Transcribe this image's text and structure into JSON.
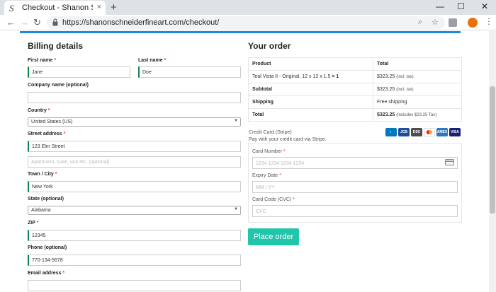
{
  "browser": {
    "tab_title": "Checkout - Shanon Schneider",
    "tab_favicon": "S",
    "tab_close": "×",
    "new_tab": "+",
    "minimize": "—",
    "maximize": "☐",
    "close": "✕",
    "url": "https://shanonschneiderfineart.com/checkout/"
  },
  "billing": {
    "heading": "Billing details",
    "first_name_label": "First name",
    "first_name_value": "Jane",
    "last_name_label": "Last name",
    "last_name_value": "Doe",
    "company_label": "Company name (optional)",
    "company_value": "",
    "country_label": "Country",
    "country_value": "United States (US)",
    "street_label": "Street address",
    "street_value": "123 Elm Street",
    "street2_placeholder": "Apartment, suite, unit etc. (optional)",
    "city_label": "Town / City",
    "city_value": "New York",
    "state_label": "State (optional)",
    "state_value": "Alabama",
    "zip_label": "ZIP",
    "zip_value": "12345",
    "phone_label": "Phone (optional)",
    "phone_value": "770-134-5678",
    "email_label": "Email address",
    "email_value": "",
    "required_mark": "*"
  },
  "order": {
    "heading": "Your order",
    "col_product": "Product",
    "col_total": "Total",
    "item_name": "Teal Vista II - Original, 12 x 12 x 1.5",
    "item_qty": "× 1",
    "item_total": "$323.25",
    "item_tax_note": "(incl. tax)",
    "subtotal_label": "Subtotal",
    "subtotal_value": "$323.25",
    "subtotal_tax_note": "(incl. tax)",
    "shipping_label": "Shipping",
    "shipping_value": "Free shipping",
    "total_label": "Total",
    "total_value": "$323.25",
    "total_tax_note": "(includes $23.25 Tax)"
  },
  "payment": {
    "method_title": "Credit Card (Stripe)",
    "method_desc": "Pay with your credit card via Stripe.",
    "card_number_label": "Card Number",
    "card_number_placeholder": "1234 1234 1234 1234",
    "expiry_label": "Expiry Date",
    "expiry_placeholder": "MM / YY",
    "cvc_label": "Card Code (CVC)",
    "cvc_placeholder": "CVC",
    "place_order": "Place order",
    "card_brands": [
      "Diners",
      "JCB",
      "Discover",
      "MasterCard",
      "AMEX",
      "VISA"
    ],
    "required_mark": "*"
  },
  "colors": {
    "accent": "#1fc6aa",
    "strip": "#1e88e5",
    "required": "#e2401c",
    "valid_border": "#0f834d"
  }
}
